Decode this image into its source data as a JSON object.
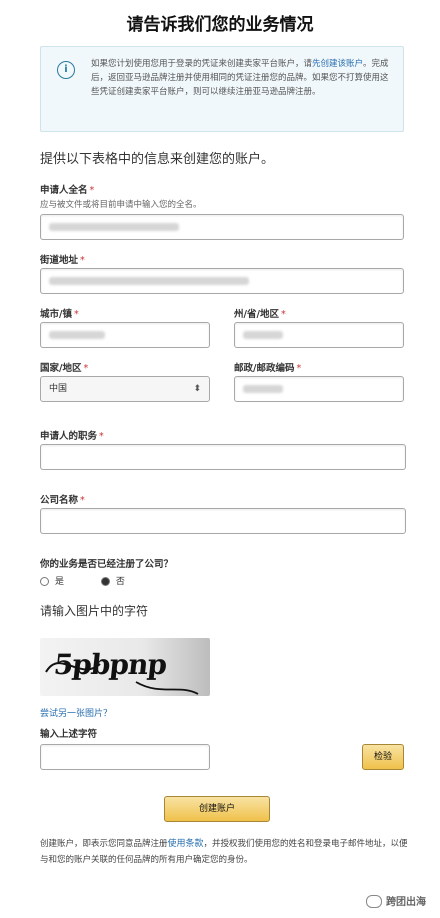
{
  "page": {
    "title": "请告诉我们您的业务情况",
    "intro": "提供以下表格中的信息来创建您的账户。"
  },
  "notice": {
    "icon": "info-icon",
    "text_before_link": "如果您计划使用您用于登录的凭证来创建卖家平台账户，请",
    "link": "先创建该账户",
    "text_after_link": "。完成后，返回亚马逊品牌注册并使用相同的凭证注册您的品牌。如果您不打算使用这些凭证创建卖家平台账户，则可以继续注册亚马逊品牌注册。"
  },
  "form": {
    "applicant_name": {
      "label": "申请人全名",
      "required_mark": "*",
      "hint": "应与被文件或将目前申请中输入您的全名。"
    },
    "street_address": {
      "label": "街道地址",
      "required_mark": "*"
    },
    "city": {
      "label": "城市/镇",
      "required_mark": "*"
    },
    "state": {
      "label": "州/省/地区",
      "required_mark": "*"
    },
    "country": {
      "label": "国家/地区",
      "required_mark": "*",
      "selected": "中国",
      "arrow": "⬍"
    },
    "postal": {
      "label": "邮政/邮政编码",
      "required_mark": "*"
    },
    "job_title": {
      "label": "申请人的职务",
      "required_mark": "*"
    },
    "company": {
      "label": "公司名称",
      "required_mark": "*"
    },
    "registered_question": "你的业务是否已经注册了公司？",
    "radio_yes": "是",
    "radio_no": "否",
    "radio_selected": "否"
  },
  "captcha": {
    "title": "请输入图片中的字符",
    "image_text": "5pbpnp",
    "refresh_link": "尝试另一张图片？",
    "input_label": "输入上述字符",
    "check_button": "检验"
  },
  "submit_button": "创建账户",
  "footer": {
    "text_before_link": "创建账户，即表示您同意品牌注册",
    "link": "使用条款",
    "text_after_link": "，并授权我们使用您的姓名和登录电子邮件地址，以便与和您的账户关联的任何品牌的所有用户确定您的身份。"
  },
  "watermark": "跨团出海"
}
